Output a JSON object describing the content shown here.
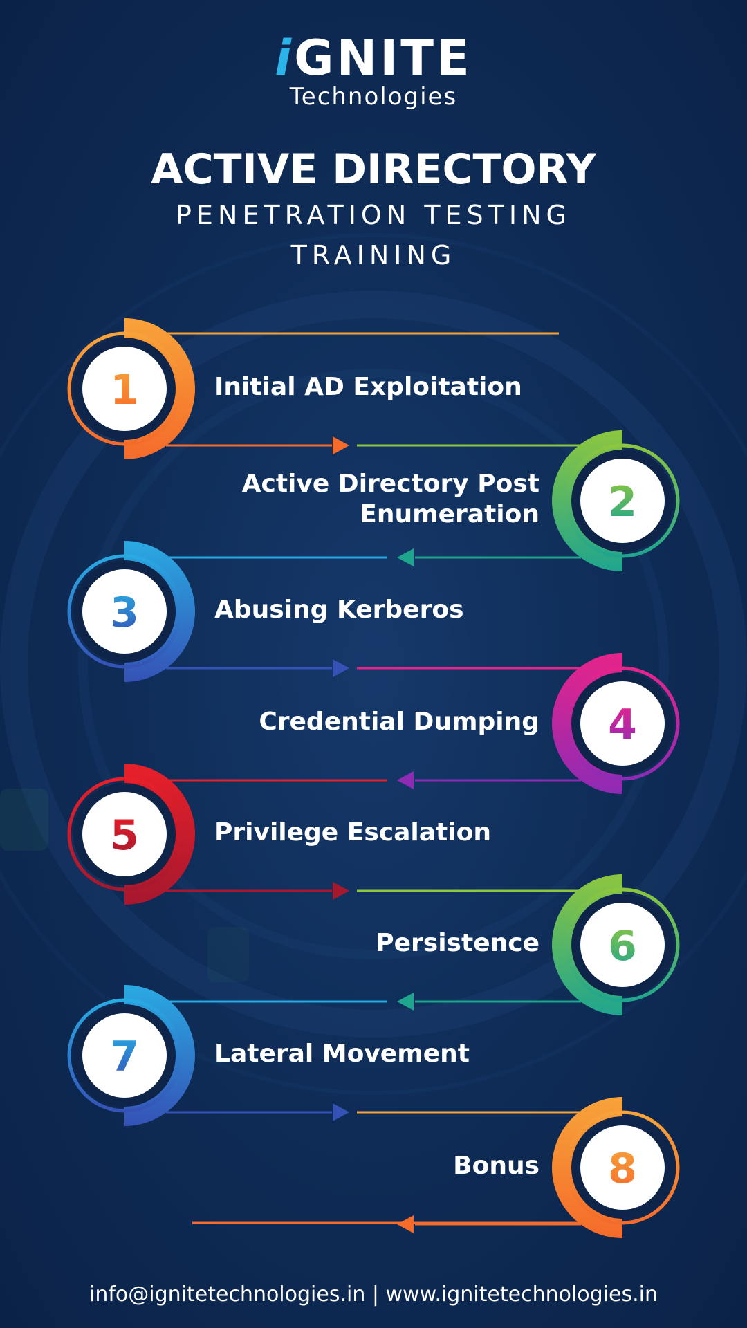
{
  "brand": {
    "logo_i": "i",
    "logo_rest": "GNITE",
    "tagline": "Technologies"
  },
  "header": {
    "title": "ACTIVE DIRECTORY",
    "subtitle_line1": "PENETRATION TESTING",
    "subtitle_line2": "TRAINING"
  },
  "steps": [
    {
      "number": "1",
      "label": "Initial AD Exploitation",
      "color_start": "#f7a33a",
      "color_end": "#f56b2a"
    },
    {
      "number": "2",
      "label_line1": "Active Directory Post",
      "label_line2": "Enumeration",
      "color_start": "#8dc63f",
      "color_end": "#1fa58e"
    },
    {
      "number": "3",
      "label": "Abusing Kerberos",
      "color_start": "#29aae2",
      "color_end": "#3552b6"
    },
    {
      "number": "4",
      "label": "Credential Dumping",
      "color_start": "#e6248a",
      "color_end": "#8e2bb5"
    },
    {
      "number": "5",
      "label": "Privilege Escalation",
      "color_start": "#e8202a",
      "color_end": "#a6182e"
    },
    {
      "number": "6",
      "label": "Persistence",
      "color_start": "#8dc63f",
      "color_end": "#1fa58e"
    },
    {
      "number": "7",
      "label": "Lateral Movement",
      "color_start": "#29aae2",
      "color_end": "#3552b6"
    },
    {
      "number": "8",
      "label": "Bonus",
      "color_start": "#f7a33a",
      "color_end": "#f56b2a"
    }
  ],
  "footer": {
    "text": "info@ignitetechnologies.in | www.ignitetechnologies.in"
  }
}
